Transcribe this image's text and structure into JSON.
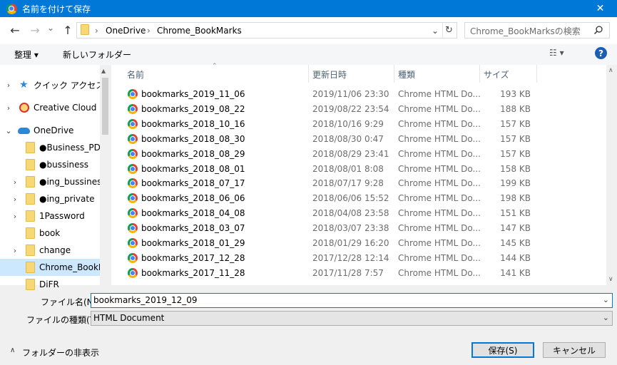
{
  "window": {
    "title": "名前を付けて保存",
    "close_glyph": "✕"
  },
  "nav": {
    "back_glyph": "←",
    "forward_glyph": "→",
    "dropdown_glyph": "⌄",
    "up_glyph": "↑",
    "breadcrumb": [
      "OneDrive",
      "Chrome_BookMarks"
    ],
    "separator": "›",
    "refresh_glyph": "↻",
    "search_placeholder": "Chrome_BookMarksの検索"
  },
  "toolbar": {
    "organize_label": "整理 ▾",
    "new_folder_label": "新しいフォルダー",
    "view_glyph": "☷ ▾",
    "help_glyph": "?"
  },
  "tree": [
    {
      "label": "クイック アクセス",
      "chevron": "›",
      "icon": "star-icon"
    },
    {
      "label": "Creative Cloud Fil",
      "chevron": "›",
      "icon": "creative-cloud-icon"
    },
    {
      "label": "OneDrive",
      "chevron": "⌄",
      "icon": "cloud-icon"
    },
    {
      "label": "●Business_PDF",
      "chevron": "",
      "icon": "folder-icon"
    },
    {
      "label": "●bussiness",
      "chevron": "",
      "icon": "folder-icon"
    },
    {
      "label": "●ing_bussiness",
      "chevron": "›",
      "icon": "folder-icon"
    },
    {
      "label": "●ing_private",
      "chevron": "›",
      "icon": "folder-icon"
    },
    {
      "label": "1Password",
      "chevron": "›",
      "icon": "folder-icon"
    },
    {
      "label": "book",
      "chevron": "",
      "icon": "folder-icon"
    },
    {
      "label": "change",
      "chevron": "›",
      "icon": "folder-icon"
    },
    {
      "label": "Chrome_BookM",
      "chevron": "",
      "icon": "folder-icon",
      "selected": true
    },
    {
      "label": "DiFR",
      "chevron": "",
      "icon": "folder-icon"
    }
  ],
  "columns": {
    "name": "名前",
    "date": "更新日時",
    "type": "種類",
    "size": "サイズ"
  },
  "files": [
    {
      "name": "bookmarks_2019_11_06",
      "date": "2019/11/06 23:30",
      "type": "Chrome HTML Do...",
      "size": "193 KB"
    },
    {
      "name": "bookmarks_2019_08_22",
      "date": "2019/08/22 23:54",
      "type": "Chrome HTML Do...",
      "size": "188 KB"
    },
    {
      "name": "bookmarks_2018_10_16",
      "date": "2018/10/16 9:29",
      "type": "Chrome HTML Do...",
      "size": "157 KB"
    },
    {
      "name": "bookmarks_2018_08_30",
      "date": "2018/08/30 0:47",
      "type": "Chrome HTML Do...",
      "size": "157 KB"
    },
    {
      "name": "bookmarks_2018_08_29",
      "date": "2018/08/29 23:41",
      "type": "Chrome HTML Do...",
      "size": "157 KB"
    },
    {
      "name": "bookmarks_2018_08_01",
      "date": "2018/08/01 8:08",
      "type": "Chrome HTML Do...",
      "size": "158 KB"
    },
    {
      "name": "bookmarks_2018_07_17",
      "date": "2018/07/17 9:28",
      "type": "Chrome HTML Do...",
      "size": "199 KB"
    },
    {
      "name": "bookmarks_2018_06_06",
      "date": "2018/06/06 15:52",
      "type": "Chrome HTML Do...",
      "size": "198 KB"
    },
    {
      "name": "bookmarks_2018_04_08",
      "date": "2018/04/08 23:58",
      "type": "Chrome HTML Do...",
      "size": "151 KB"
    },
    {
      "name": "bookmarks_2018_03_07",
      "date": "2018/03/07 23:38",
      "type": "Chrome HTML Do...",
      "size": "147 KB"
    },
    {
      "name": "bookmarks_2018_01_29",
      "date": "2018/01/29 16:20",
      "type": "Chrome HTML Do...",
      "size": "145 KB"
    },
    {
      "name": "bookmarks_2017_12_28",
      "date": "2017/12/28 12:14",
      "type": "Chrome HTML Do...",
      "size": "144 KB"
    },
    {
      "name": "bookmarks_2017_11_28",
      "date": "2017/11/28 7:57",
      "type": "Chrome HTML Do...",
      "size": "141 KB"
    }
  ],
  "form": {
    "filename_label": "ファイル名(N):",
    "filename_value": "bookmarks_2019_12_09",
    "filetype_label": "ファイルの種類(T):",
    "filetype_value": "HTML Document",
    "hide_folders_label": "フォルダーの非表示",
    "hide_glyph": "∧",
    "save_label": "保存(S)",
    "cancel_label": "キャンセル"
  },
  "colors": {
    "titlebar": "#0078d7",
    "selected": "#cce8ff"
  }
}
